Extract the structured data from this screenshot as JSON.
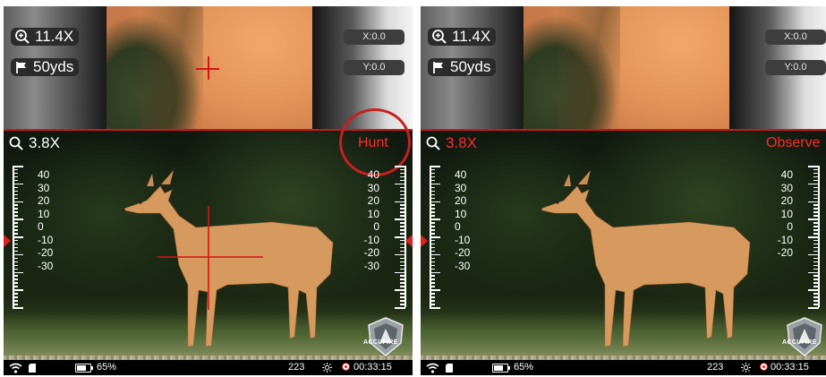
{
  "left_panel": {
    "top_zoom": "11.4X",
    "top_distance": "50yds",
    "x_coord": "X:0.0",
    "y_coord": "Y:0.0",
    "main_zoom": "3.8X",
    "mode_label": "Hunt",
    "scale_left": [
      "40",
      "30",
      "20",
      "10",
      "0",
      "-10",
      "-20",
      "-30"
    ],
    "scale_right": [
      "40",
      "30",
      "20",
      "10",
      "0",
      "-10",
      "-20",
      "-30"
    ],
    "logo_text": "ACCUFIRE",
    "battery": "65%",
    "shot_count": "223",
    "timer": "00:33:15",
    "battery_level": 0.65,
    "reticle_visible": true,
    "mode_highlighted": true
  },
  "right_panel": {
    "top_zoom": "11.4X",
    "top_distance": "50yds",
    "x_coord": "X:0.0",
    "y_coord": "Y:0.0",
    "main_zoom": "3.8X",
    "mode_label": "Observe",
    "scale_left": [
      "40",
      "30",
      "20",
      "10",
      "0",
      "-10",
      "-20",
      "-30"
    ],
    "scale_right": [
      "40",
      "30",
      "20",
      "10",
      "0",
      "-10",
      "-20"
    ],
    "logo_text": "ACCUFIRE",
    "battery": "65%",
    "shot_count": "223",
    "timer": "00:33:15",
    "battery_level": 0.65,
    "reticle_visible": false,
    "mode_highlighted": false
  },
  "colors": {
    "accent_red": "#d21414",
    "hud_text": "#ffffff",
    "pill_bg": "#2b2b2b",
    "status_bar_bg": "#000000"
  },
  "icons": {
    "zoom": "magnifier-plus-icon",
    "distance": "flag-icon",
    "main_zoom": "magnifier-icon",
    "wifi": "wifi-icon",
    "sd": "sd-card-icon",
    "battery": "battery-icon",
    "brightness": "sun-icon",
    "record": "record-icon"
  }
}
